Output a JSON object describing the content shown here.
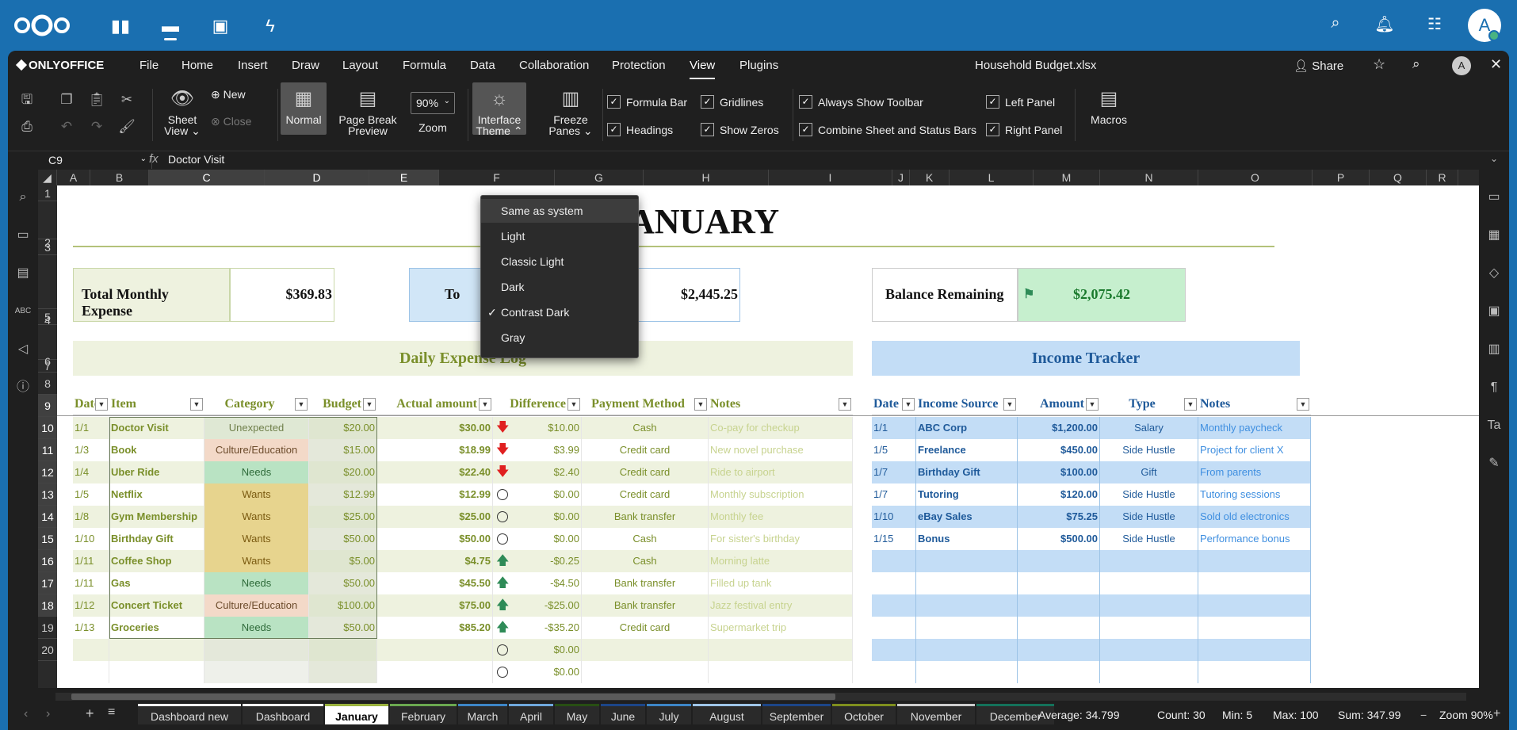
{
  "nextcloud": {
    "apps": [
      "dashboard-icon",
      "files-icon",
      "photos-icon",
      "activity-icon"
    ],
    "avatar_letter": "A"
  },
  "menubar": {
    "brand": "ONLYOFFICE",
    "items": [
      "File",
      "Home",
      "Insert",
      "Draw",
      "Layout",
      "Formula",
      "Data",
      "Collaboration",
      "Protection",
      "View",
      "Plugins"
    ],
    "active": "View",
    "doc_title": "Household Budget.xlsx",
    "share_label": "Share",
    "avatar_letter": "A"
  },
  "toolbar": {
    "sheet_view": "Sheet View",
    "new": "New",
    "close": "Close",
    "normal": "Normal",
    "page_break": "Page Break Preview",
    "zoom_value": "90%",
    "zoom_label": "Zoom",
    "interface_theme": "Interface Theme",
    "freeze_panes": "Freeze Panes",
    "formula_bar": "Formula Bar",
    "headings": "Headings",
    "gridlines": "Gridlines",
    "show_zeros": "Show Zeros",
    "always_show_toolbar": "Always Show Toolbar",
    "combine_bars": "Combine Sheet and Status Bars",
    "left_panel": "Left Panel",
    "right_panel": "Right Panel",
    "macros": "Macros"
  },
  "formula_bar": {
    "cell_ref": "C9",
    "fx": "fx",
    "content": "Doctor Visit"
  },
  "theme_menu": {
    "items": [
      "Same as system",
      "Light",
      "Classic Light",
      "Dark",
      "Contrast Dark",
      "Gray"
    ],
    "checked": "Contrast Dark",
    "highlighted": "Same as system"
  },
  "columns": [
    "A",
    "B",
    "C",
    "D",
    "E",
    "F",
    "G",
    "H",
    "I",
    "J",
    "K",
    "L",
    "M",
    "N",
    "O",
    "P",
    "Q",
    "R"
  ],
  "rows": [
    "1",
    "2",
    "3",
    "4",
    "5",
    "6",
    "7",
    "8",
    "9",
    "10",
    "11",
    "12",
    "13",
    "14",
    "15",
    "16",
    "17",
    "18",
    "19",
    "20"
  ],
  "sheet": {
    "title": "JANUARY",
    "total_expense_label": "Total Monthly Expense",
    "total_expense_value": "$369.83",
    "total_income_label": "To",
    "total_income_value": "$2,445.25",
    "balance_label": "Balance Remaining",
    "balance_value": "$2,075.42",
    "expense_log_title": "Daily Expense Log",
    "income_tracker_title": "Income Tracker",
    "expense_headers": [
      "Date",
      "Item",
      "Category",
      "Budget",
      "Actual amount",
      "Difference",
      "Payment Method",
      "Notes"
    ],
    "income_headers": [
      "Date",
      "Income Source",
      "Amount",
      "Type",
      "Notes"
    ],
    "expenses": [
      {
        "date": "1/1",
        "item": "Doctor Visit",
        "category": "Unexpected",
        "budget": "$20.00",
        "actual": "$30.00",
        "arrow": "down",
        "diff": "$10.00",
        "method": "Cash",
        "notes": "Co-pay for checkup"
      },
      {
        "date": "1/3",
        "item": "Book",
        "category": "Culture/Education",
        "budget": "$15.00",
        "actual": "$18.99",
        "arrow": "down",
        "diff": "$3.99",
        "method": "Credit card",
        "notes": "New novel purchase"
      },
      {
        "date": "1/4",
        "item": "Uber Ride",
        "category": "Needs",
        "budget": "$20.00",
        "actual": "$22.40",
        "arrow": "down",
        "diff": "$2.40",
        "method": "Credit card",
        "notes": "Ride to airport"
      },
      {
        "date": "1/5",
        "item": "Netflix",
        "category": "Wants",
        "budget": "$12.99",
        "actual": "$12.99",
        "arrow": "circle",
        "diff": "$0.00",
        "method": "Credit card",
        "notes": "Monthly subscription"
      },
      {
        "date": "1/8",
        "item": "Gym Membership",
        "category": "Wants",
        "budget": "$25.00",
        "actual": "$25.00",
        "arrow": "circle",
        "diff": "$0.00",
        "method": "Bank transfer",
        "notes": "Monthly fee"
      },
      {
        "date": "1/10",
        "item": "Birthday Gift",
        "category": "Wants",
        "budget": "$50.00",
        "actual": "$50.00",
        "arrow": "circle",
        "diff": "$0.00",
        "method": "Cash",
        "notes": "For sister's birthday"
      },
      {
        "date": "1/11",
        "item": "Coffee Shop",
        "category": "Wants",
        "budget": "$5.00",
        "actual": "$4.75",
        "arrow": "up",
        "diff": "-$0.25",
        "method": "Cash",
        "notes": "Morning latte"
      },
      {
        "date": "1/11",
        "item": "Gas",
        "category": "Needs",
        "budget": "$50.00",
        "actual": "$45.50",
        "arrow": "up",
        "diff": "-$4.50",
        "method": "Bank transfer",
        "notes": "Filled up tank"
      },
      {
        "date": "1/12",
        "item": "Concert Ticket",
        "category": "Culture/Education",
        "budget": "$100.00",
        "actual": "$75.00",
        "arrow": "up",
        "diff": "-$25.00",
        "method": "Bank transfer",
        "notes": "Jazz festival entry"
      },
      {
        "date": "1/13",
        "item": "Groceries",
        "category": "Needs",
        "budget": "$50.00",
        "actual": "$85.20",
        "arrow": "up",
        "diff": "-$35.20",
        "method": "Credit card",
        "notes": "Supermarket trip"
      },
      {
        "date": "",
        "item": "",
        "category": "",
        "budget": "",
        "actual": "",
        "arrow": "circle",
        "diff": "$0.00",
        "method": "",
        "notes": ""
      },
      {
        "date": "",
        "item": "",
        "category": "",
        "budget": "",
        "actual": "",
        "arrow": "circle",
        "diff": "$0.00",
        "method": "",
        "notes": ""
      }
    ],
    "income": [
      {
        "date": "1/1",
        "source": "ABC Corp",
        "amount": "$1,200.00",
        "type": "Salary",
        "notes": "Monthly paycheck"
      },
      {
        "date": "1/5",
        "source": "Freelance",
        "amount": "$450.00",
        "type": "Side Hustle",
        "notes": "Project for client X"
      },
      {
        "date": "1/7",
        "source": "Birthday Gift",
        "amount": "$100.00",
        "type": "Gift",
        "notes": "From parents"
      },
      {
        "date": "1/7",
        "source": "Tutoring",
        "amount": "$120.00",
        "type": "Side Hustle",
        "notes": "Tutoring sessions"
      },
      {
        "date": "1/10",
        "source": "eBay Sales",
        "amount": "$75.25",
        "type": "Side Hustle",
        "notes": "Sold old electronics"
      },
      {
        "date": "1/15",
        "source": "Bonus",
        "amount": "$500.00",
        "type": "Side Hustle",
        "notes": "Performance bonus"
      }
    ],
    "category_colors": {
      "Unexpected": "#dfe8d4",
      "Culture/Education": "#f3d9c8",
      "Needs": "#b9e3c3",
      "Wants": "#e7d48e"
    }
  },
  "sheet_tabs": [
    {
      "name": "Dashboard new",
      "color": "#ffffff"
    },
    {
      "name": "Dashboard",
      "color": "#ffffff"
    },
    {
      "name": "January",
      "color": "#9ab23e"
    },
    {
      "name": "February",
      "color": "#6aa84f"
    },
    {
      "name": "March",
      "color": "#3d85c6"
    },
    {
      "name": "April",
      "color": "#6fa8dc"
    },
    {
      "name": "May",
      "color": "#274e13"
    },
    {
      "name": "June",
      "color": "#1c4587"
    },
    {
      "name": "July",
      "color": "#3d85c6"
    },
    {
      "name": "August",
      "color": "#9fc5e8"
    },
    {
      "name": "September",
      "color": "#1c4587"
    },
    {
      "name": "October",
      "color": "#7f8f1e"
    },
    {
      "name": "November",
      "color": "#cccccc"
    },
    {
      "name": "December",
      "color": "#14715a"
    }
  ],
  "active_tab": "January",
  "status": {
    "average": "Average: 34.799",
    "count": "Count: 30",
    "min": "Min: 5",
    "max": "Max: 100",
    "sum": "Sum: 347.99",
    "zoom": "Zoom 90%"
  }
}
